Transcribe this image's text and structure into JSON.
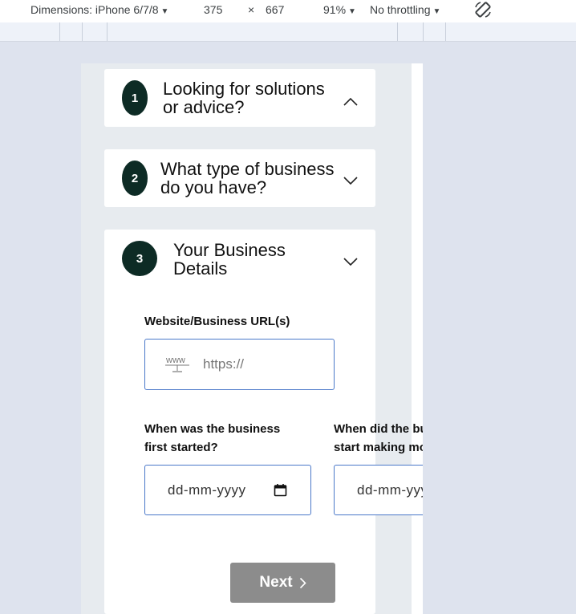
{
  "devtools": {
    "dimensions_label": "Dimensions: iPhone 6/7/8",
    "width": "375",
    "times": "×",
    "height": "667",
    "zoom": "91%",
    "throttling": "No throttling",
    "rotate_icon": "rotate-icon"
  },
  "steps": [
    {
      "number": "1",
      "title_line1": "Looking for solutions",
      "title_line2": "or advice?",
      "expanded": true
    },
    {
      "number": "2",
      "title_line1": "What type of business",
      "title_line2": "do you have?",
      "expanded": false
    },
    {
      "number": "3",
      "title_line1": "Your Business",
      "title_line2": "Details",
      "expanded": false
    }
  ],
  "form": {
    "website_label": "Website/Business URL(s)",
    "website_placeholder": "https://",
    "www_icon": "www-icon",
    "started_label_line1": "When was the business",
    "started_label_line2": "first started?",
    "started_value": "dd-mm-yyyy",
    "money_label_line1": "When did the business",
    "money_label_line2": "start making money?",
    "money_value": "dd-mm-yyyy",
    "next_label": "Next"
  }
}
